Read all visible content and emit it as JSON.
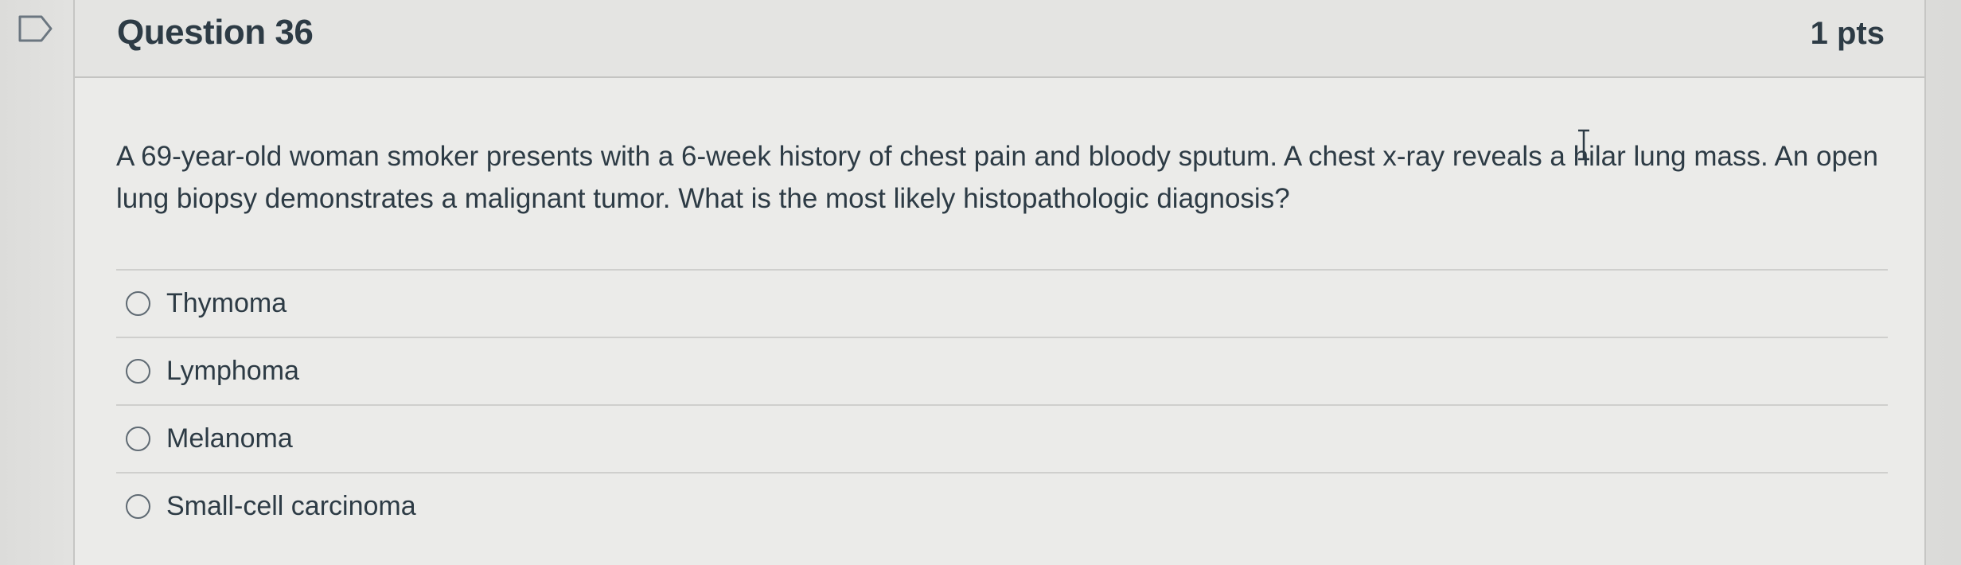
{
  "question": {
    "title": "Question 36",
    "points": "1 pts",
    "text": "A 69-year-old woman smoker presents with a 6-week history of chest pain and bloody sputum. A chest x-ray reveals a hilar lung mass. An open lung biopsy demonstrates a malignant tumor. What is the most likely histopathologic diagnosis?"
  },
  "answers": [
    {
      "label": "Thymoma"
    },
    {
      "label": "Lymphoma"
    },
    {
      "label": "Melanoma"
    },
    {
      "label": "Small-cell carcinoma"
    }
  ],
  "icons": {
    "flag": "flag-question-icon",
    "cursor": "text-cursor-icon"
  },
  "colors": {
    "text": "#2d3b45",
    "background": "#e9e9e7"
  }
}
